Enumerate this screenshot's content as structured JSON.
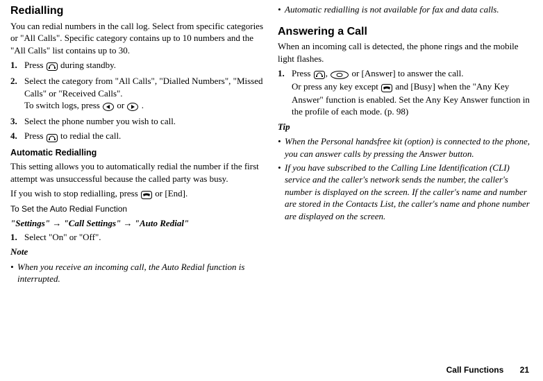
{
  "left": {
    "redialling": {
      "heading": "Redialling",
      "intro": "You can redial numbers in the call log. Select from specific categories or \"All Calls\". Specific category contains up to 10 numbers and the \"All Calls\" list contains up to 30.",
      "steps": [
        {
          "n": "1.",
          "text_before": "Press ",
          "text_after": " during standby."
        },
        {
          "n": "2.",
          "line1": "Select the category from \"All Calls\", \"Dialled Numbers\", \"Missed Calls\" or \"Received Calls\".",
          "line2_before": "To switch logs, press ",
          "line2_mid": " or ",
          "line2_after": "."
        },
        {
          "n": "3.",
          "text": "Select the phone number you wish to call."
        },
        {
          "n": "4.",
          "text_before": "Press ",
          "text_after": " to redial the call."
        }
      ]
    },
    "auto": {
      "heading": "Automatic Redialling",
      "intro": "This setting allows you to automatically redial the number if the first attempt was unsuccessful because the called party was busy.",
      "stop_before": "If you wish to stop redialling, press ",
      "stop_after": " or [End].",
      "toset": "To Set the Auto Redial Function",
      "path_parts": [
        "\"Settings\"",
        "\"Call Settings\"",
        "\"Auto Redial\""
      ],
      "step1": {
        "n": "1.",
        "text": "Select \"On\" or \"Off\"."
      },
      "note_label": "Note",
      "notes": [
        "When you receive an incoming call, the Auto Redial function is interrupted."
      ]
    }
  },
  "right": {
    "note2": "Automatic redialling is not available for fax and data calls.",
    "answer": {
      "heading": "Answering a Call",
      "intro": "When an incoming call is detected, the phone rings and the mobile light flashes.",
      "step1": {
        "n": "1.",
        "a_before": "Press ",
        "a_mid1": ", ",
        "a_mid2": " or [Answer] to answer the call.",
        "b_before": "Or press any key except ",
        "b_after": " and [Busy] when the \"Any Key Answer\" function is enabled. Set the Any Key Answer function in the profile of each mode. (p. 98)"
      },
      "tip_label": "Tip",
      "tips": [
        "When the Personal handsfree kit (option) is connected to the phone, you can answer calls by pressing the Answer button.",
        "If you have subscribed to the Calling Line Identification (CLI) service and the caller's network sends the number, the caller's number is displayed on the screen. If the caller's name and number are stored in the Contacts List, the caller's name and phone number are displayed on the screen."
      ]
    }
  },
  "footer": {
    "section": "Call Functions",
    "page": "21"
  }
}
